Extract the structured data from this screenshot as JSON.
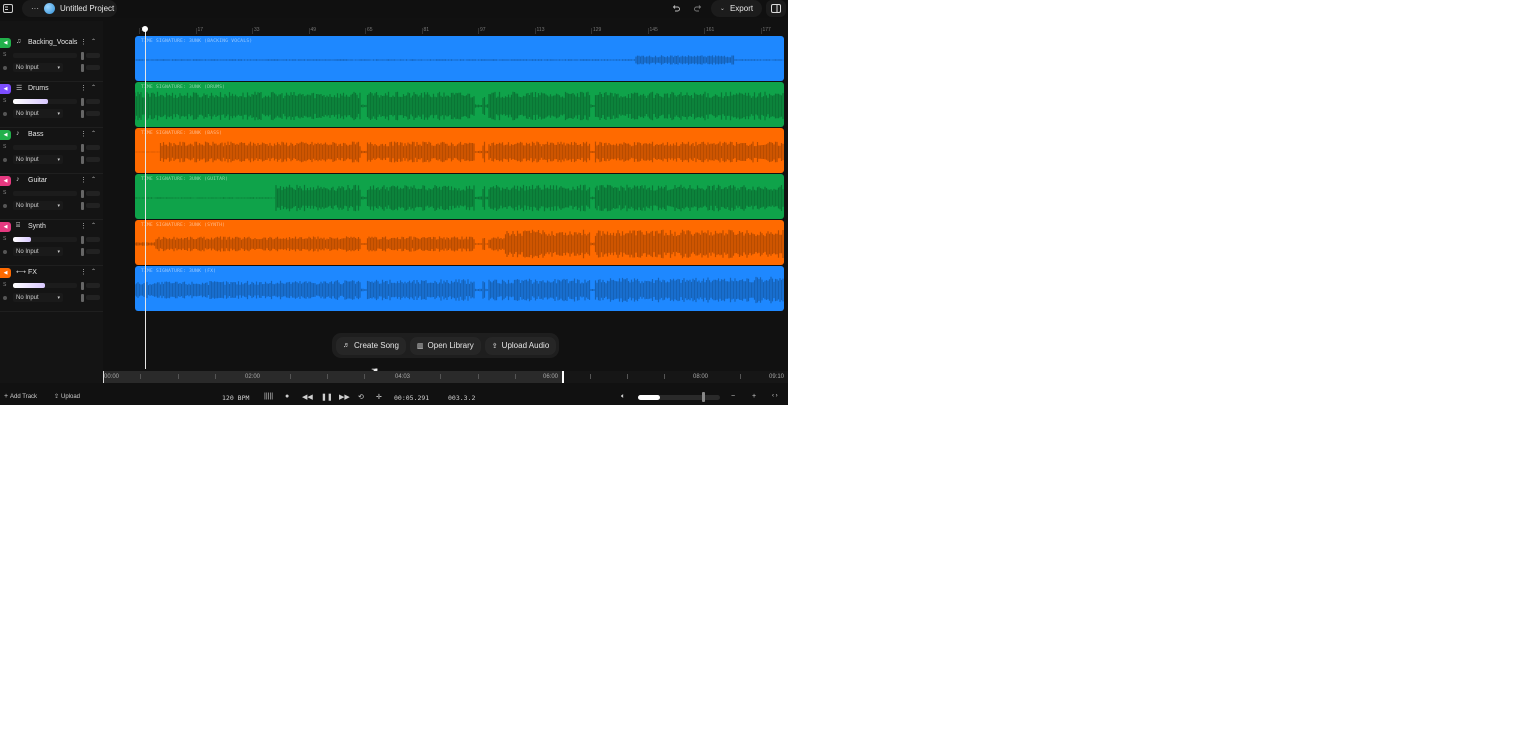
{
  "app": {
    "project_name": "Untitled Project",
    "export_label": "Export"
  },
  "tracks": [
    {
      "name": "Backing_Vocals",
      "icon": "music-note-icon",
      "mute_color": "#22b04b",
      "clip_color": "#1e88ff",
      "clip_label": "TIME SIGNATURE: 3UNK (BACKING VOCALS)",
      "input": "No Input",
      "meter_level": 0.0
    },
    {
      "name": "Drums",
      "icon": "drum-icon",
      "mute_color": "#7c4dff",
      "clip_color": "#0fa34a",
      "clip_label": "TIME SIGNATURE: 3UNK (DRUMS)",
      "input": "No Input",
      "meter_level": 0.55
    },
    {
      "name": "Bass",
      "icon": "guitar-icon",
      "mute_color": "#22b04b",
      "clip_color": "#ff6a00",
      "clip_label": "TIME SIGNATURE: 3UNK (BASS)",
      "input": "No Input",
      "meter_level": 0.0
    },
    {
      "name": "Guitar",
      "icon": "guitar-icon",
      "mute_color": "#e53980",
      "clip_color": "#0fa34a",
      "clip_label": "TIME SIGNATURE: 3UNK (GUITAR)",
      "input": "No Input",
      "meter_level": 0.0
    },
    {
      "name": "Synth",
      "icon": "keyboard-icon",
      "mute_color": "#e53980",
      "clip_color": "#ff6a00",
      "clip_label": "TIME SIGNATURE: 3UNK (SYNTH)",
      "input": "No Input",
      "meter_level": 0.28
    },
    {
      "name": "FX",
      "icon": "fx-icon",
      "mute_color": "#ff6a00",
      "clip_color": "#1e88ff",
      "clip_label": "TIME SIGNATURE: 3UNK (FX)",
      "input": "No Input",
      "meter_level": 0.5
    }
  ],
  "track_row_labels": {
    "solo": "S"
  },
  "ruler": {
    "labels": [
      "1",
      "17",
      "33",
      "49",
      "65",
      "81",
      "97",
      "113",
      "129",
      "145",
      "161",
      "177"
    ]
  },
  "actions": {
    "create_song": "Create Song",
    "open_library": "Open Library",
    "upload_audio": "Upload Audio"
  },
  "overview": {
    "labels": [
      "00:00",
      "02:00",
      "04:03",
      "06:00",
      "08:00",
      "09:10"
    ]
  },
  "transport": {
    "add_track": "Add Track",
    "upload": "Upload",
    "bpm": "120 BPM",
    "time": "00:05.291",
    "position": "003.3.2",
    "master_volume": 0.6
  }
}
